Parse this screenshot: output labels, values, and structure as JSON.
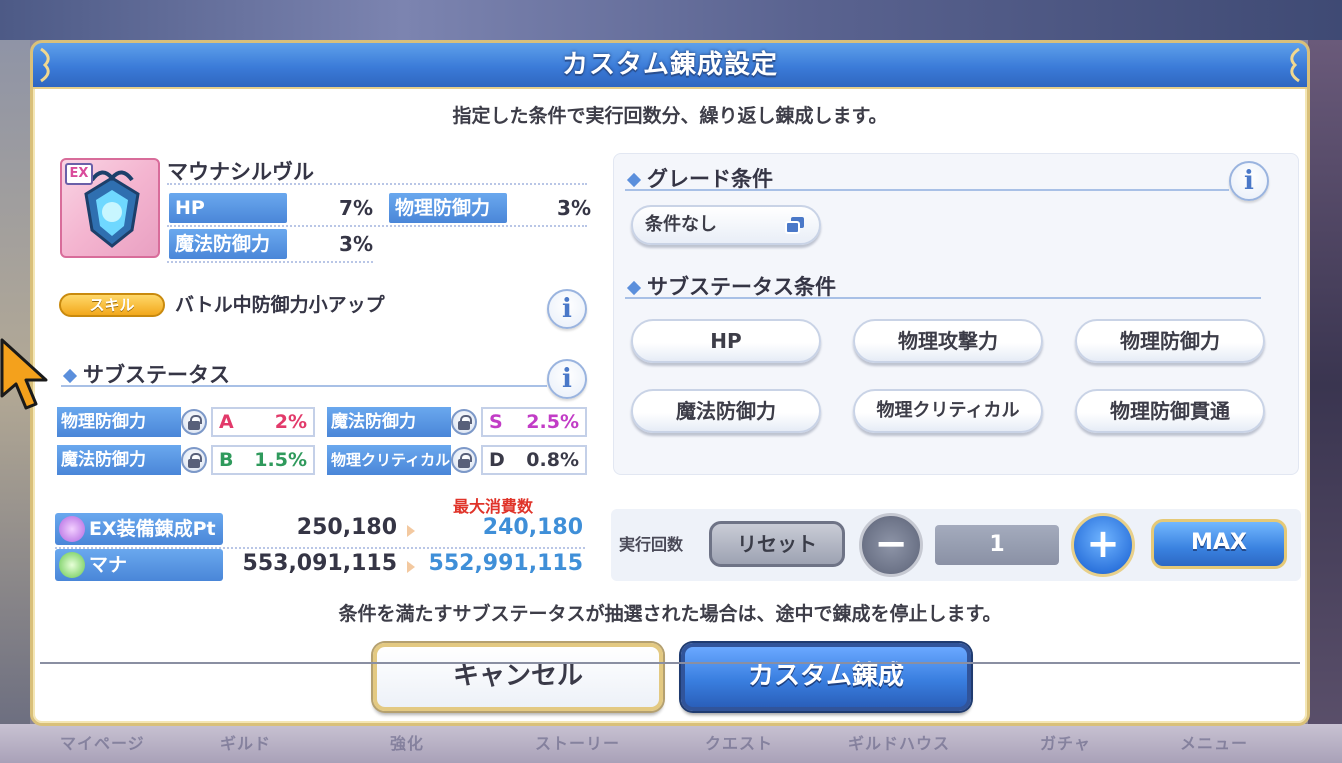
{
  "dialog": {
    "title": "カスタム錬成設定",
    "intro": "指定した条件で実行回数分、繰り返し錬成します。",
    "notice": "条件を満たすサブステータスが抽選された場合は、途中で錬成を停止します。",
    "cancel_label": "キャンセル",
    "confirm_label": "カスタム錬成"
  },
  "equipment": {
    "ex_badge": "EX",
    "name": "マウナシルヴル",
    "stats": [
      {
        "label": "HP",
        "value": "7%"
      },
      {
        "label": "物理防御力",
        "value": "3%"
      },
      {
        "label": "魔法防御力",
        "value": "3%"
      }
    ],
    "skill_tag": "スキル",
    "skill_text": "バトル中防御力小アップ"
  },
  "substats": {
    "title": "サブステータス",
    "items": [
      {
        "label": "物理防御力",
        "grade": "A",
        "value": "2%",
        "color": "#e23a6a"
      },
      {
        "label": "魔法防御力",
        "grade": "S",
        "value": "2.5%",
        "color": "#c23cc6"
      },
      {
        "label": "魔法防御力",
        "grade": "B",
        "value": "1.5%",
        "color": "#2f9a5c"
      },
      {
        "label": "物理クリティカル",
        "grade": "D",
        "value": "0.8%",
        "color": "#3a3a48"
      }
    ]
  },
  "resources": {
    "max_consume_label": "最大消費数",
    "items": [
      {
        "label": "EX装備錬成Pt",
        "current": "250,180",
        "after": "240,180",
        "icon": "ex-pt-icon"
      },
      {
        "label": "マナ",
        "current": "553,091,115",
        "after": "552,991,115",
        "icon": "mana-icon"
      }
    ]
  },
  "grade_condition": {
    "title": "グレード条件",
    "selected": "条件なし"
  },
  "sub_condition": {
    "title": "サブステータス条件",
    "options": [
      "HP",
      "物理攻撃力",
      "物理防御力",
      "魔法防御力",
      "物理クリティカル",
      "物理防御貫通"
    ]
  },
  "execution": {
    "label": "実行回数",
    "reset_label": "リセット",
    "count": "1",
    "max_label": "MAX"
  },
  "background_nav": [
    "マイページ",
    "ギルド",
    "強化",
    "ストーリー",
    "クエスト",
    "ギルドハウス",
    "ガチャ",
    "メニュー"
  ],
  "colors": {
    "header_blue": "#3b7bd8",
    "label_blue": "#4a86d8",
    "gold_border": "#d9c07a",
    "after_value_blue": "#3f8fd8",
    "max_consume_red": "#e0342a"
  }
}
